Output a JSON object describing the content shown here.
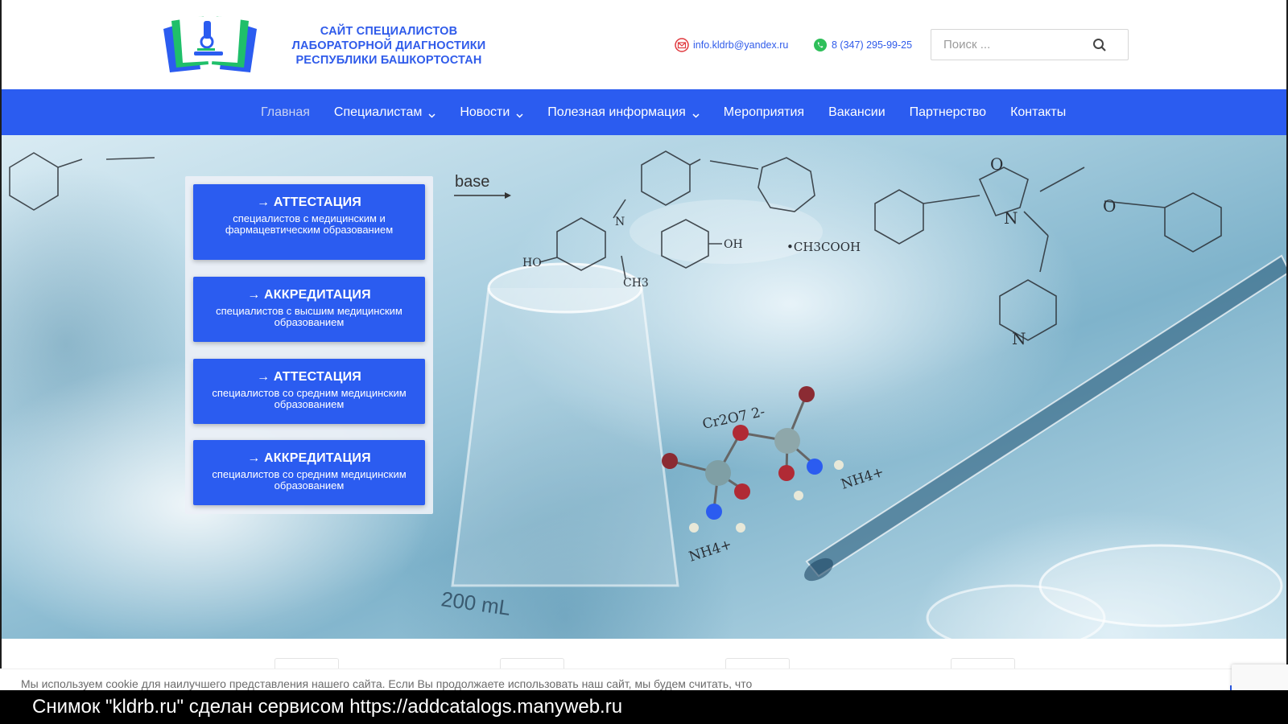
{
  "site": {
    "title_lines": [
      "САЙТ СПЕЦИАЛИСТОВ",
      "ЛАБОРАТОРНОЙ ДИАГНОСТИКИ",
      "РЕСПУБЛИКИ БАШКОРТОСТАН"
    ],
    "email": "info.kldrb@yandex.ru",
    "phone": "8 (347) 295-99-25"
  },
  "search": {
    "placeholder": "Поиск ..."
  },
  "nav": {
    "items": [
      {
        "label": "Главная"
      },
      {
        "label": "Специалистам"
      },
      {
        "label": "Новости"
      },
      {
        "label": "Полезная информация"
      },
      {
        "label": "Мероприятия"
      },
      {
        "label": "Вакансии"
      },
      {
        "label": "Партнерство"
      },
      {
        "label": "Контакты"
      }
    ]
  },
  "hero": {
    "chem_labels": [
      "base",
      "HO",
      "OH",
      "N",
      "CH3",
      "•CH3COOH",
      "N",
      "O",
      "O",
      "N",
      "Cr2O7 2-",
      "NH4+",
      "NH4+",
      "200 mL"
    ]
  },
  "cards": [
    {
      "title": "→ АТТЕСТАЦИЯ",
      "subtitle": "специалистов с медицинским и фармацевтическим образованием"
    },
    {
      "title": "→ АККРЕДИТАЦИЯ",
      "subtitle": "специалистов с высшим медицинским образованием"
    },
    {
      "title": "→ АТТЕСТАЦИЯ",
      "subtitle": "специалистов со средним медицинским образованием"
    },
    {
      "title": "→ АККРЕДИТАЦИЯ",
      "subtitle": "специалистов со средним медицинским образованием"
    }
  ],
  "cookie": {
    "text": "Мы используем cookie для наилучшего представления нашего сайта. Если Вы продолжаете использовать наш сайт, мы будем считать, что"
  },
  "watermark": "Снимок \"kldrb.ru\" сделан сервисом https://addcatalogs.manyweb.ru"
}
